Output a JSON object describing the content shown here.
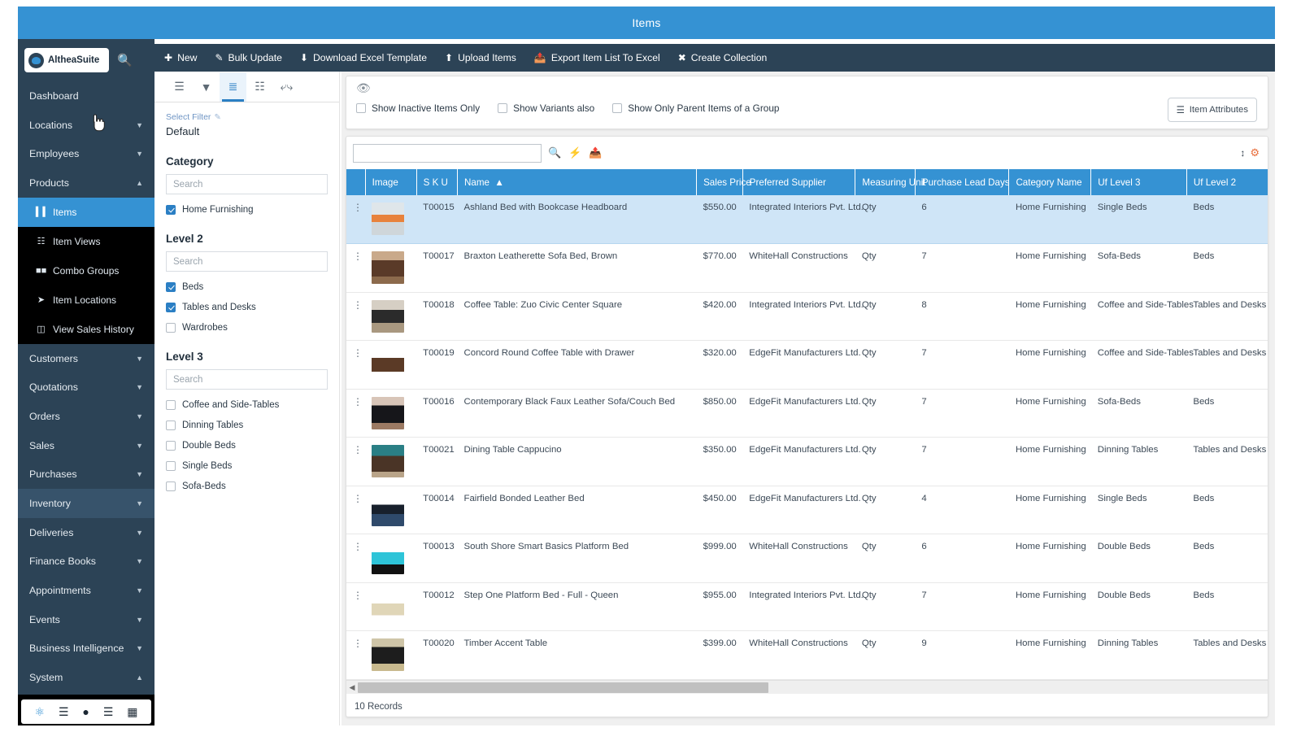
{
  "window": {
    "title": "Items"
  },
  "brand": {
    "name": "AltheaSuite",
    "logo_icon": "bird-logo-icon",
    "search_icon": "search-icon"
  },
  "sidebar": {
    "items": [
      {
        "label": "Dashboard",
        "expandable": false,
        "state": ""
      },
      {
        "label": "Locations",
        "expandable": true,
        "state": "collapsed"
      },
      {
        "label": "Employees",
        "expandable": true,
        "state": "collapsed"
      },
      {
        "label": "Products",
        "expandable": true,
        "state": "expanded"
      }
    ],
    "sub_items": [
      {
        "label": "Items",
        "icon": "bars-icon",
        "selected": true
      },
      {
        "label": "Item Views",
        "icon": "sitemap-icon",
        "selected": false
      },
      {
        "label": "Combo Groups",
        "icon": "boxes-icon",
        "selected": false
      },
      {
        "label": "Item Locations",
        "icon": "location-arrow-icon",
        "selected": false
      },
      {
        "label": "View Sales History",
        "icon": "archive-icon",
        "selected": false
      }
    ],
    "items_lower": [
      {
        "label": "Customers",
        "expandable": true,
        "state": "collapsed"
      },
      {
        "label": "Quotations",
        "expandable": true,
        "state": "collapsed"
      },
      {
        "label": "Orders",
        "expandable": true,
        "state": "collapsed"
      },
      {
        "label": "Sales",
        "expandable": true,
        "state": "collapsed"
      },
      {
        "label": "Purchases",
        "expandable": true,
        "state": "collapsed"
      },
      {
        "label": "Inventory",
        "expandable": true,
        "state": "collapsed",
        "highlighted": true
      },
      {
        "label": "Deliveries",
        "expandable": true,
        "state": "collapsed"
      },
      {
        "label": "Finance Books",
        "expandable": true,
        "state": "collapsed"
      },
      {
        "label": "Appointments",
        "expandable": true,
        "state": "collapsed"
      },
      {
        "label": "Events",
        "expandable": true,
        "state": "collapsed"
      },
      {
        "label": "Business Intelligence",
        "expandable": true,
        "state": "collapsed"
      },
      {
        "label": "System",
        "expandable": true,
        "state": "expanded"
      }
    ],
    "bottom_icons": [
      "app-logo-icon",
      "menu-icon",
      "account-icon",
      "list-icon",
      "grid-icon"
    ]
  },
  "toolbar": {
    "buttons": [
      {
        "label": "New",
        "icon": "plus-circle-icon"
      },
      {
        "label": "Bulk Update",
        "icon": "edit-icon"
      },
      {
        "label": "Download Excel Template",
        "icon": "download-icon"
      },
      {
        "label": "Upload Items",
        "icon": "upload-icon"
      },
      {
        "label": "Export Item List To Excel",
        "icon": "file-export-icon"
      },
      {
        "label": "Create Collection",
        "icon": "collection-icon"
      }
    ]
  },
  "view_tabs": [
    {
      "icon": "list-view-icon",
      "active": false
    },
    {
      "icon": "filter-icon",
      "active": false
    },
    {
      "icon": "ordered-list-icon",
      "active": true
    },
    {
      "icon": "hierarchy-icon",
      "active": false
    },
    {
      "icon": "collapse-icon",
      "active": false
    }
  ],
  "filter_panel": {
    "select_filter_label": "Select Filter",
    "edit_icon": "pencil-icon",
    "current_filter": "Default",
    "sections": [
      {
        "label": "Category",
        "search_placeholder": "Search",
        "options": [
          {
            "label": "Home Furnishing",
            "checked": true
          }
        ]
      },
      {
        "label": "Level 2",
        "search_placeholder": "Search",
        "options": [
          {
            "label": "Beds",
            "checked": true
          },
          {
            "label": "Tables and Desks",
            "checked": true
          },
          {
            "label": "Wardrobes",
            "checked": false
          }
        ]
      },
      {
        "label": "Level 3",
        "search_placeholder": "Search",
        "options": [
          {
            "label": "Coffee and Side-Tables",
            "checked": false
          },
          {
            "label": "Dinning Tables",
            "checked": false
          },
          {
            "label": "Double Beds",
            "checked": false
          },
          {
            "label": "Single Beds",
            "checked": false
          },
          {
            "label": "Sofa-Beds",
            "checked": false
          }
        ]
      }
    ]
  },
  "options_card": {
    "eye_icon": "eye-slash-icon",
    "checkboxes": [
      {
        "label": "Show Inactive Items Only",
        "checked": false
      },
      {
        "label": "Show Variants also",
        "checked": false
      },
      {
        "label": "Show Only Parent Items of a Group",
        "checked": false
      }
    ],
    "item_attributes_button": {
      "label": "Item Attributes",
      "icon": "bars-icon"
    }
  },
  "grid_toolbar": {
    "search_value": "",
    "search_placeholder": "",
    "icons": [
      "search-icon",
      "lightning-icon",
      "export-icon"
    ],
    "right_icons": [
      "sort-updown-icon",
      "gear-icon"
    ]
  },
  "table": {
    "columns": [
      {
        "key": "menu",
        "label": ""
      },
      {
        "key": "image",
        "label": "Image"
      },
      {
        "key": "sku",
        "label": "S K U"
      },
      {
        "key": "name",
        "label": "Name",
        "sort": "asc",
        "sort_icon": "caret-up-icon"
      },
      {
        "key": "sales_price",
        "label": "Sales Price",
        "align": "right"
      },
      {
        "key": "preferred_supplier",
        "label": "Preferred Supplier"
      },
      {
        "key": "measuring_unit",
        "label": "Measuring Unit"
      },
      {
        "key": "purchase_lead_days",
        "label": "Purchase Lead Days"
      },
      {
        "key": "category_name",
        "label": "Category Name"
      },
      {
        "key": "uf_level_3",
        "label": "Uf Level 3"
      },
      {
        "key": "uf_level_2",
        "label": "Uf Level 2"
      }
    ],
    "rows": [
      {
        "selected": true,
        "sku": "T00015",
        "name": "Ashland Bed with Bookcase Headboard",
        "sales_price": "$550.00",
        "preferred_supplier": "Integrated Interiors Pvt. Ltd.",
        "measuring_unit": "Qty",
        "purchase_lead_days": "6",
        "category_name": "Home Furnishing",
        "uf_level_3": "Single Beds",
        "uf_level_2": "Beds",
        "thumb": "bed-white-orange"
      },
      {
        "selected": false,
        "sku": "T00017",
        "name": "Braxton Leatherette Sofa Bed, Brown",
        "sales_price": "$770.00",
        "preferred_supplier": "WhiteHall Constructions",
        "measuring_unit": "Qty",
        "purchase_lead_days": "7",
        "category_name": "Home Furnishing",
        "uf_level_3": "Sofa-Beds",
        "uf_level_2": "Beds",
        "thumb": "sofa-brown"
      },
      {
        "selected": false,
        "sku": "T00018",
        "name": "Coffee Table: Zuo Civic Center Square",
        "sales_price": "$420.00",
        "preferred_supplier": "Integrated Interiors Pvt. Ltd.",
        "measuring_unit": "Qty",
        "purchase_lead_days": "8",
        "category_name": "Home Furnishing",
        "uf_level_3": "Coffee and Side-Tables",
        "uf_level_2": "Tables and Desks",
        "thumb": "coffee-table-black"
      },
      {
        "selected": false,
        "sku": "T00019",
        "name": "Concord Round Coffee Table with Drawer",
        "sales_price": "$320.00",
        "preferred_supplier": "EdgeFit Manufacturers Ltd.",
        "measuring_unit": "Qty",
        "purchase_lead_days": "7",
        "category_name": "Home Furnishing",
        "uf_level_3": "Coffee and Side-Tables",
        "uf_level_2": "Tables and Desks",
        "thumb": "round-table-wood"
      },
      {
        "selected": false,
        "sku": "T00016",
        "name": "Contemporary Black Faux Leather Sofa/Couch Bed",
        "sales_price": "$850.00",
        "preferred_supplier": "EdgeFit Manufacturers Ltd.",
        "measuring_unit": "Qty",
        "purchase_lead_days": "7",
        "category_name": "Home Furnishing",
        "uf_level_3": "Sofa-Beds",
        "uf_level_2": "Beds",
        "thumb": "sofa-black"
      },
      {
        "selected": false,
        "sku": "T00021",
        "name": "Dining Table Cappucino",
        "sales_price": "$350.00",
        "preferred_supplier": "EdgeFit Manufacturers Ltd.",
        "measuring_unit": "Qty",
        "purchase_lead_days": "7",
        "category_name": "Home Furnishing",
        "uf_level_3": "Dinning Tables",
        "uf_level_2": "Tables and Desks",
        "thumb": "dining-set-teal"
      },
      {
        "selected": false,
        "sku": "T00014",
        "name": "Fairfield Bonded Leather Bed",
        "sales_price": "$450.00",
        "preferred_supplier": "EdgeFit Manufacturers Ltd.",
        "measuring_unit": "Qty",
        "purchase_lead_days": "4",
        "category_name": "Home Furnishing",
        "uf_level_3": "Single Beds",
        "uf_level_2": "Beds",
        "thumb": "bed-dark-blue"
      },
      {
        "selected": false,
        "sku": "T00013",
        "name": "South Shore Smart Basics Platform Bed",
        "sales_price": "$999.00",
        "preferred_supplier": "WhiteHall Constructions",
        "measuring_unit": "Qty",
        "purchase_lead_days": "6",
        "category_name": "Home Furnishing",
        "uf_level_3": "Double Beds",
        "uf_level_2": "Beds",
        "thumb": "bed-cyan"
      },
      {
        "selected": false,
        "sku": "T00012",
        "name": "Step One Platform Bed - Full - Queen",
        "sales_price": "$955.00",
        "preferred_supplier": "Integrated Interiors Pvt. Ltd.",
        "measuring_unit": "Qty",
        "purchase_lead_days": "7",
        "category_name": "Home Furnishing",
        "uf_level_3": "Double Beds",
        "uf_level_2": "Beds",
        "thumb": "bed-beige"
      },
      {
        "selected": false,
        "sku": "T00020",
        "name": "Timber Accent Table",
        "sales_price": "$399.00",
        "preferred_supplier": "WhiteHall Constructions",
        "measuring_unit": "Qty",
        "purchase_lead_days": "9",
        "category_name": "Home Furnishing",
        "uf_level_3": "Dinning Tables",
        "uf_level_2": "Tables and Desks",
        "thumb": "accent-table-black"
      }
    ],
    "record_count": "10 Records"
  },
  "colors": {
    "accent": "#3592d3",
    "sidebar": "#2c4356",
    "header_blue": "#3592d3",
    "selected_row": "#cfe5f7",
    "gear_orange": "#e86c3a"
  }
}
